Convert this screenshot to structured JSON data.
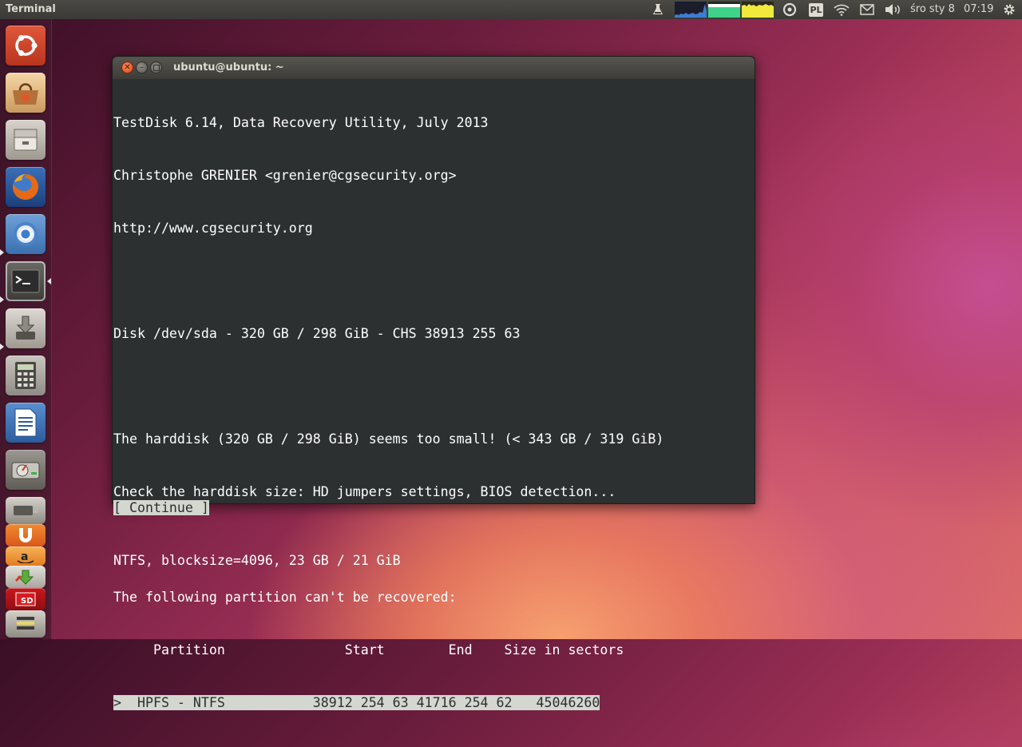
{
  "top_panel": {
    "app_name": "Terminal",
    "keyboard_layout": "PL",
    "date": "śro sty  8",
    "time": "07:19"
  },
  "launcher": {
    "items": [
      {
        "name": "dash-home"
      },
      {
        "name": "ubuntu-software-center"
      },
      {
        "name": "files"
      },
      {
        "name": "firefox"
      },
      {
        "name": "chromium"
      },
      {
        "name": "terminal"
      },
      {
        "name": "installer"
      },
      {
        "name": "calculator"
      },
      {
        "name": "libreoffice-writer"
      },
      {
        "name": "disk-utility"
      },
      {
        "name": "startup-disk-creator"
      },
      {
        "name": "ubuntu-one"
      },
      {
        "name": "amazon"
      },
      {
        "name": "updater"
      },
      {
        "name": "sd-card"
      },
      {
        "name": "more"
      }
    ]
  },
  "window": {
    "title": "ubuntu@ubuntu: ~"
  },
  "terminal": {
    "header": {
      "line1": "TestDisk 6.14, Data Recovery Utility, July 2013",
      "line2": "Christophe GRENIER <grenier@cgsecurity.org>",
      "line3": "http://www.cgsecurity.org"
    },
    "disk_line": "Disk /dev/sda - 320 GB / 298 GiB - CHS 38913 255 63",
    "warning_line1": "The harddisk (320 GB / 298 GiB) seems too small! (< 343 GB / 319 GiB)",
    "warning_line2": "Check the harddisk size: HD jumpers settings, BIOS detection...",
    "partition_msg": "The following partition can't be recovered:",
    "table_header": "     Partition               Start        End    Size in sectors",
    "partition_row": ">  HPFS - NTFS           38912 254 63 41716 254 62   45046260",
    "continue_button": "[ Continue ]",
    "status_line": "NTFS, blocksize=4096, 23 GB / 21 GiB"
  },
  "colors": {
    "terminal_bg": "#2d3031",
    "highlight_bg": "#d3d7cf",
    "close_button": "#df4a16"
  }
}
